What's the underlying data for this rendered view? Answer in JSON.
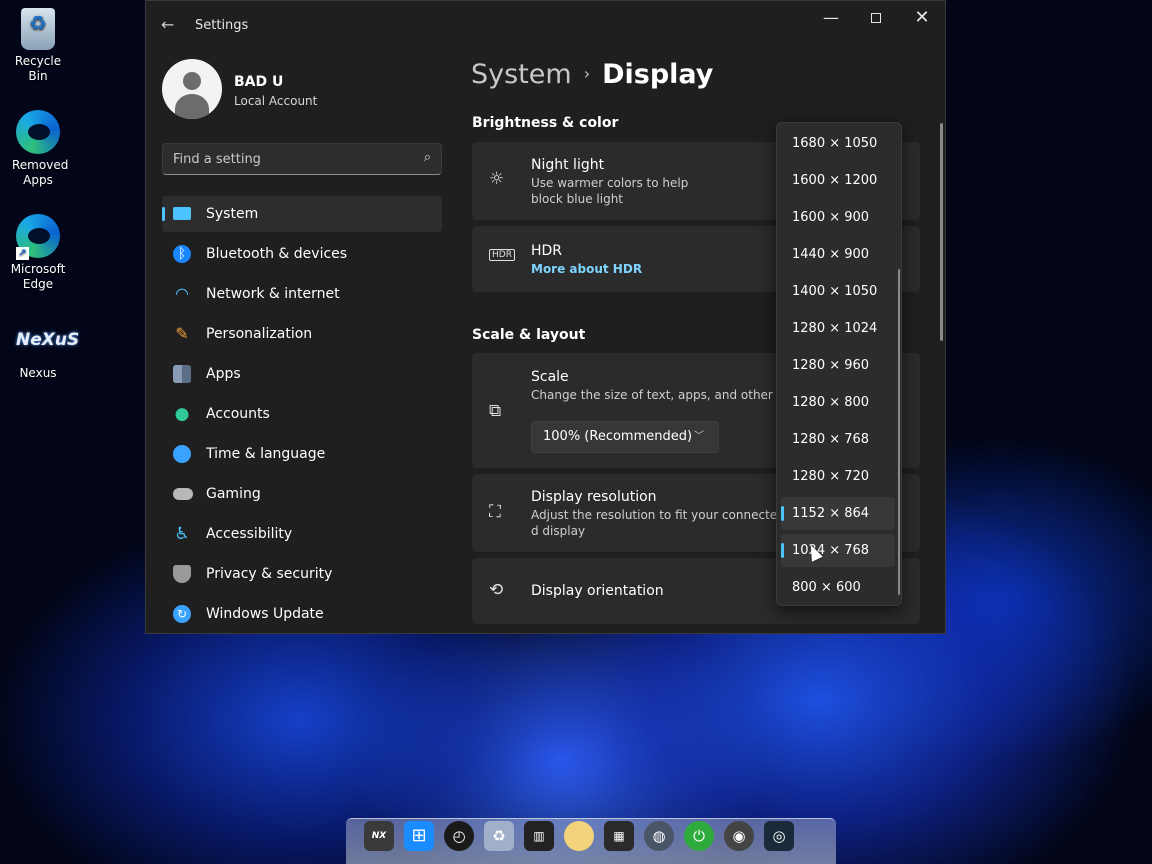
{
  "desktop": {
    "icons": [
      {
        "label": "Recycle Bin"
      },
      {
        "label": "Removed Apps"
      },
      {
        "label": "Microsoft Edge"
      },
      {
        "label": "Nexus",
        "glyph": "NeXuS"
      }
    ]
  },
  "window": {
    "title": "Settings",
    "back_glyph": "←",
    "min_glyph": "—",
    "close_glyph": "✕"
  },
  "profile": {
    "name": "BAD U",
    "account_type": "Local Account"
  },
  "search": {
    "placeholder": "Find a setting",
    "value": "",
    "icon": "⌕"
  },
  "nav": {
    "items": [
      {
        "label": "System",
        "active": true,
        "icon": "monitor-icon",
        "color": "#4cc2ff"
      },
      {
        "label": "Bluetooth & devices",
        "icon": "bluetooth-icon",
        "color": "#1a86ff"
      },
      {
        "label": "Network & internet",
        "icon": "wifi-icon",
        "color": "#4cc2ff"
      },
      {
        "label": "Personalization",
        "icon": "brush-icon",
        "color": "#f2a23c"
      },
      {
        "label": "Apps",
        "icon": "apps-icon",
        "color": "#8a9bb5"
      },
      {
        "label": "Accounts",
        "icon": "person-icon",
        "color": "#2fc99a"
      },
      {
        "label": "Time & language",
        "icon": "globe-clock-icon",
        "color": "#3aa3ff"
      },
      {
        "label": "Gaming",
        "icon": "gamepad-icon",
        "color": "#b8b8b8"
      },
      {
        "label": "Accessibility",
        "icon": "accessibility-icon",
        "color": "#4cc2ff"
      },
      {
        "label": "Privacy & security",
        "icon": "shield-icon",
        "color": "#9a9a9a"
      },
      {
        "label": "Windows Update",
        "icon": "update-icon",
        "color": "#3aa3ff"
      }
    ]
  },
  "content": {
    "breadcrumb": {
      "parent": "System",
      "separator": "›",
      "current": "Display"
    },
    "sections": {
      "brightness": "Brightness & color",
      "scale_layout": "Scale & layout"
    },
    "night_light": {
      "title": "Night light",
      "desc_line1": "Use warmer colors to help",
      "desc_line2": "block blue light"
    },
    "hdr": {
      "title": "HDR",
      "link": "More about HDR",
      "badge": "HDR"
    },
    "scale": {
      "title": "Scale",
      "desc": "Change the size of text, apps, and other items",
      "value": "100% (Recommended)"
    },
    "display_resolution": {
      "title": "Display resolution",
      "desc_line1": "Adjust the resolution to fit your connecte",
      "desc_line2": "d display"
    },
    "display_orientation": {
      "title": "Display orientation"
    }
  },
  "resolution_dropdown": {
    "selected": "1152 × 864",
    "options": [
      "1680 × 1050",
      "1600 × 1200",
      "1600 × 900",
      "1440 × 900",
      "1400 × 1050",
      "1280 × 1024",
      "1280 × 960",
      "1280 × 800",
      "1280 × 768",
      "1280 × 720",
      "1152 × 864",
      "1024 × 768",
      "800 × 600"
    ]
  },
  "dock": {
    "items": [
      {
        "icon": "nexus-icon",
        "color": "#3a3a3a"
      },
      {
        "icon": "windows-start-icon",
        "color": "#1a8cff"
      },
      {
        "icon": "clock-icon",
        "color": "#1a1a1a"
      },
      {
        "icon": "recycle-bin-icon",
        "color": "#9fb0c8"
      },
      {
        "icon": "cpu-meter-icon",
        "color": "#222222"
      },
      {
        "icon": "weather-icon",
        "color": "#f2d27a"
      },
      {
        "icon": "calendar-icon",
        "color": "#2a2a2a"
      },
      {
        "icon": "globe-icon",
        "color": "#4a5668"
      },
      {
        "icon": "power-icon",
        "color": "#2faa3c"
      },
      {
        "icon": "media-icon",
        "color": "#444444"
      },
      {
        "icon": "camera-icon",
        "color": "#1a2a3a"
      }
    ]
  }
}
